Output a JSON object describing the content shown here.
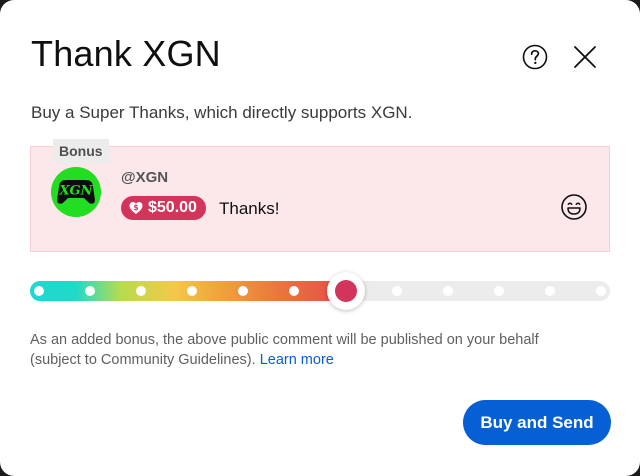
{
  "dialog": {
    "title": "Thank XGN",
    "subtitle": "Buy a Super Thanks, which directly supports XGN.",
    "icons": {
      "help": "help-circle-icon",
      "close": "close-icon"
    }
  },
  "preview": {
    "bonus_label": "Bonus",
    "avatar_text": "XGN",
    "username": "@XGN",
    "price": "$50.00",
    "comment": "Thanks!",
    "icons": {
      "price": "dollar-heart-icon",
      "emoji": "smiley-emoji-icon"
    }
  },
  "slider": {
    "stops": 12,
    "selected_index": 6,
    "accent_color": "#d2345a"
  },
  "note": {
    "text": "As an added bonus, the above public comment will be published on your behalf (subject to Community Guidelines).",
    "link": "Learn more"
  },
  "actions": {
    "buy_label": "Buy and Send"
  },
  "colors": {
    "primary": "#065fd4",
    "card_bg": "#fce8ea",
    "avatar_bg": "#22dd22"
  }
}
